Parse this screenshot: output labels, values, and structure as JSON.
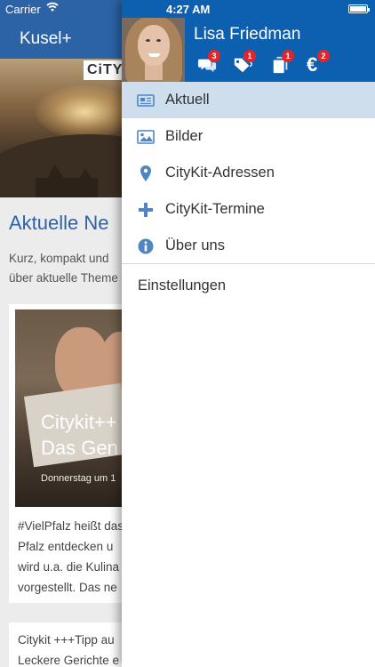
{
  "status_bar": {
    "carrier": "Carrier",
    "time": "4:27 AM",
    "battery_level": 1.0
  },
  "app": {
    "title": "Kusel+",
    "hero_logo": "CiTY",
    "section_heading": "Aktuelle Ne",
    "intro_lines": [
      "Kurz, kompakt und",
      "über aktuelle Theme"
    ],
    "card": {
      "title_lines": [
        "Citykit++",
        "Das Gen"
      ],
      "date": "Donnerstag um 1",
      "text_lines": [
        "#VielPfalz heißt das",
        "Pfalz entdecken u",
        "wird u.a. die Kulina",
        "vorgestellt. Das ne"
      ]
    },
    "card2": {
      "text_lines": [
        "Citykit +++Tipp au",
        "Leckere Gerichte e"
      ]
    }
  },
  "drawer": {
    "user_name": "Lisa Friedman",
    "header_icons": [
      {
        "icon": "chat-icon",
        "badge": "3"
      },
      {
        "icon": "tags-icon",
        "badge": "1"
      },
      {
        "icon": "documents-icon",
        "badge": "1"
      },
      {
        "icon": "euro-icon",
        "glyph": "€",
        "badge": "2"
      }
    ],
    "menu": [
      {
        "label": "Aktuell",
        "icon": "newspaper-icon",
        "active": true
      },
      {
        "label": "Bilder",
        "icon": "image-icon"
      },
      {
        "label": "CityKit-Adressen",
        "icon": "location-pin-icon"
      },
      {
        "label": "CityKit-Termine",
        "icon": "plus-icon"
      },
      {
        "label": "Über uns",
        "icon": "info-icon"
      }
    ],
    "settings_label": "Einstellungen"
  },
  "colors": {
    "brand_blue": "#0d5fb0",
    "nav_blue": "#2c63a6",
    "active_bg": "#cfdeed",
    "badge_red": "#e0262b",
    "icon_blue": "#4f86c0"
  }
}
